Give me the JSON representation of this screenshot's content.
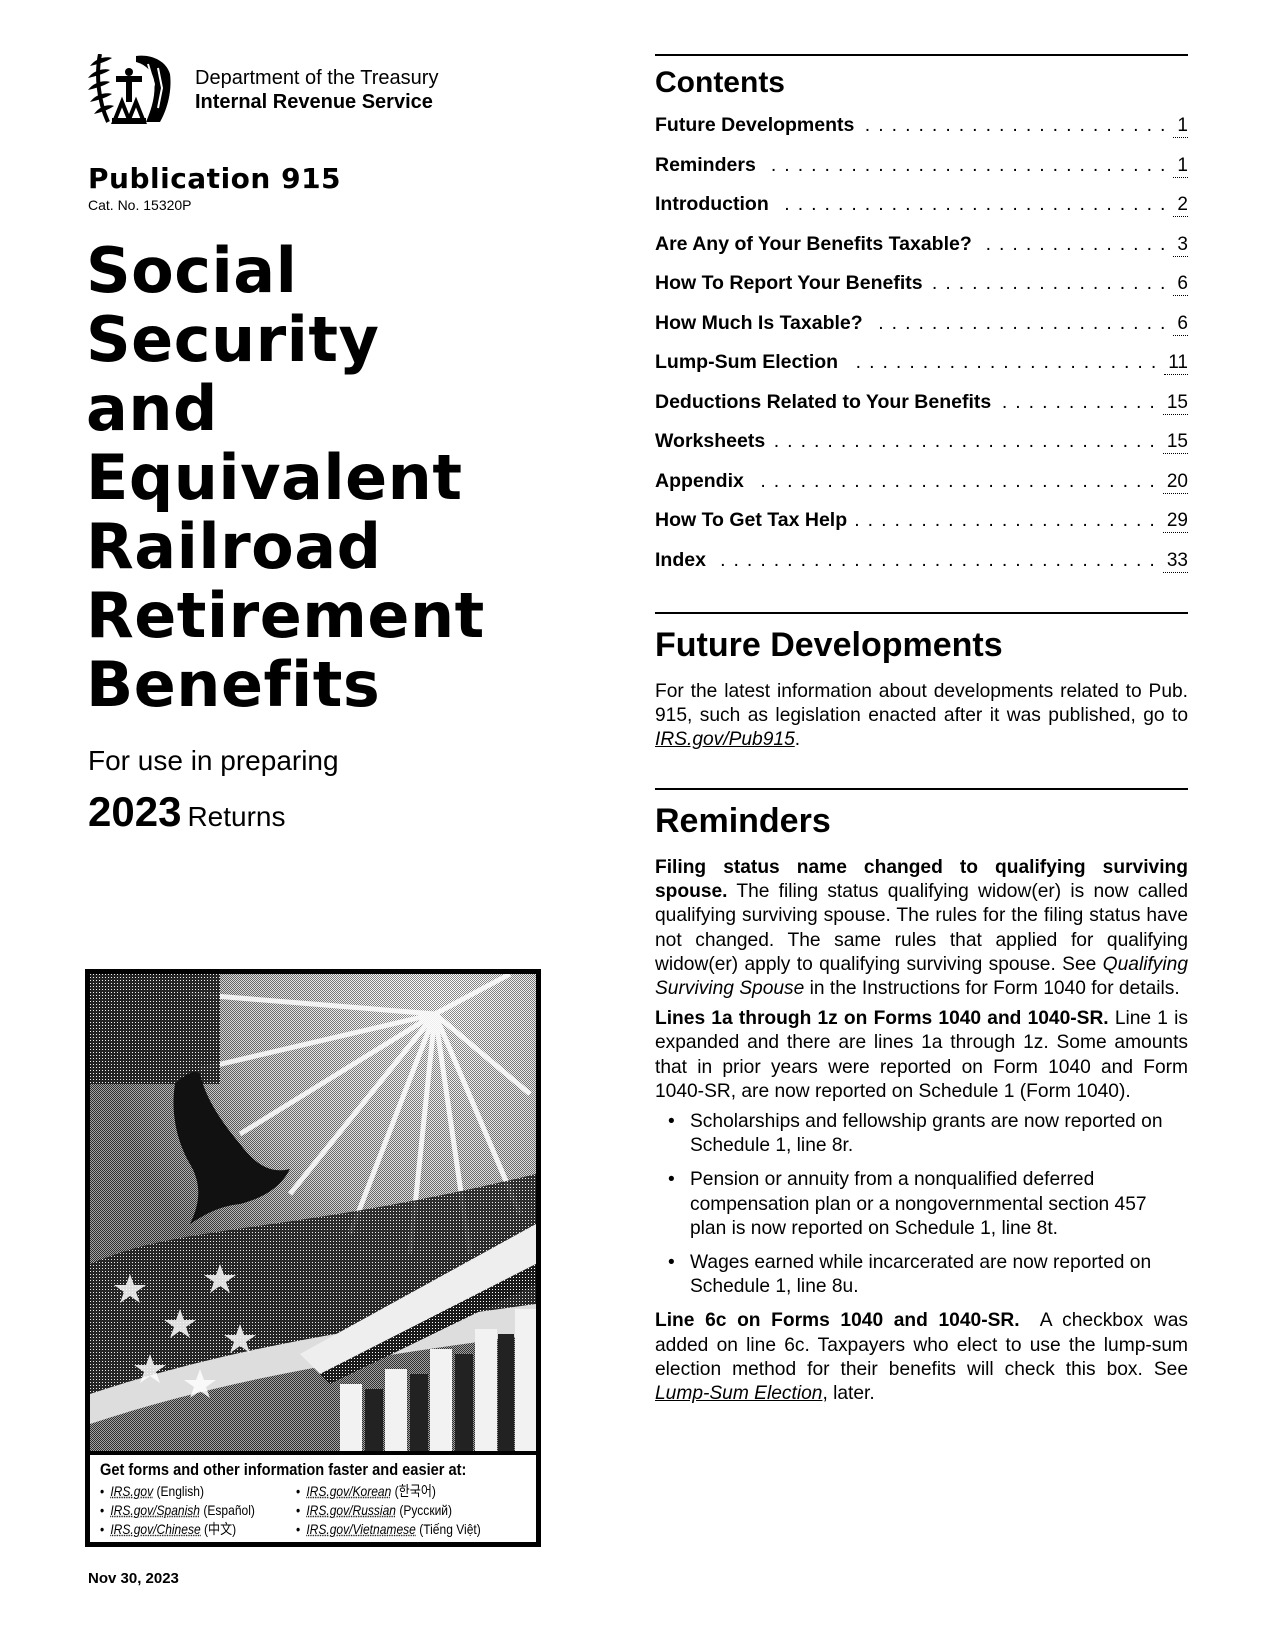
{
  "header": {
    "logo_icon": "irs-eagle-logo-icon",
    "department": "Department of the Treasury",
    "agency": "Internal Revenue Service",
    "publication": "Publication 915",
    "cat_no": "Cat. No. 15320P"
  },
  "title_lines": [
    "Social",
    "Security",
    "and",
    "Equivalent",
    "Railroad",
    "Retirement",
    "Benefits"
  ],
  "subtitle": {
    "for_use": "For use in preparing",
    "year": "2023",
    "returns": "Returns"
  },
  "cover": {
    "image_description": "Halftone illustration of an eagle in flight before fireworks, U.S. flag stars, and a columned government building",
    "info_title": "Get forms and other information faster and easier at:",
    "links": [
      {
        "url_text": "IRS.gov",
        "language": "(English)"
      },
      {
        "url_text": "IRS.gov/Korean",
        "language": "(한국어)"
      },
      {
        "url_text": "IRS.gov/Spanish",
        "language": "(Español)"
      },
      {
        "url_text": "IRS.gov/Russian",
        "language": "(Русский)"
      },
      {
        "url_text": "IRS.gov/Chinese",
        "language": "(中文)"
      },
      {
        "url_text": "IRS.gov/Vietnamese",
        "language": "(Tiếng Việt)"
      }
    ]
  },
  "date": "Nov 30, 2023",
  "contents": {
    "heading": "Contents",
    "items": [
      {
        "label": "Future Developments",
        "page": "1"
      },
      {
        "label": "Reminders",
        "page": "1"
      },
      {
        "label": "Introduction",
        "page": "2"
      },
      {
        "label": "Are Any of Your Benefits Taxable?",
        "page": "3"
      },
      {
        "label": "How To Report Your Benefits",
        "page": "6"
      },
      {
        "label": "How Much Is Taxable?",
        "page": "6"
      },
      {
        "label": "Lump-Sum Election",
        "page": "11"
      },
      {
        "label": "Deductions Related to Your Benefits",
        "page": "15"
      },
      {
        "label": "Worksheets",
        "page": "15"
      },
      {
        "label": "Appendix",
        "page": "20"
      },
      {
        "label": "How To Get Tax Help",
        "page": "29"
      },
      {
        "label": "Index",
        "page": "33"
      }
    ]
  },
  "future_developments": {
    "heading": "Future Developments",
    "text_before": "For the latest information about developments related to Pub. 915, such as legislation enacted after it was published, go to ",
    "link": "IRS.gov/Pub915",
    "text_after": "."
  },
  "reminders": {
    "heading": "Reminders",
    "p1_bold": "Filing status name changed to qualifying surviving spouse.",
    "p1_text": " The filing status qualifying widow(er) is now called qualifying surviving spouse. The rules for the filing status have not changed. The same rules that applied for qualifying widow(er) apply to qualifying surviving spouse. See ",
    "p1_italic": "Qualifying Surviving Spouse",
    "p1_text_end": " in the Instructions for Form 1040 for details.",
    "p2_bold": "Lines 1a through 1z on Forms 1040 and 1040-SR.",
    "p2_text": " Line 1 is expanded and there are lines 1a through 1z. Some amounts that in prior years were reported on Form 1040 and Form 1040-SR, are now reported on Schedule 1 (Form 1040).",
    "bullets": [
      "Scholarships and fellowship grants are now reported on Schedule 1, line 8r.",
      "Pension or annuity from a nonqualified deferred compensation plan or a nongovernmental section 457 plan is now reported on Schedule 1, line 8t.",
      "Wages earned while incarcerated are now reported on Schedule 1, line 8u."
    ],
    "p3_bold": "Line 6c on Forms 1040 and 1040-SR.",
    "p3_text": "  A checkbox was added on line 6c. Taxpayers who elect to use the lump-sum election method for their benefits will check this box. See ",
    "p3_link": "Lump-Sum Election",
    "p3_text_end": ", later."
  }
}
